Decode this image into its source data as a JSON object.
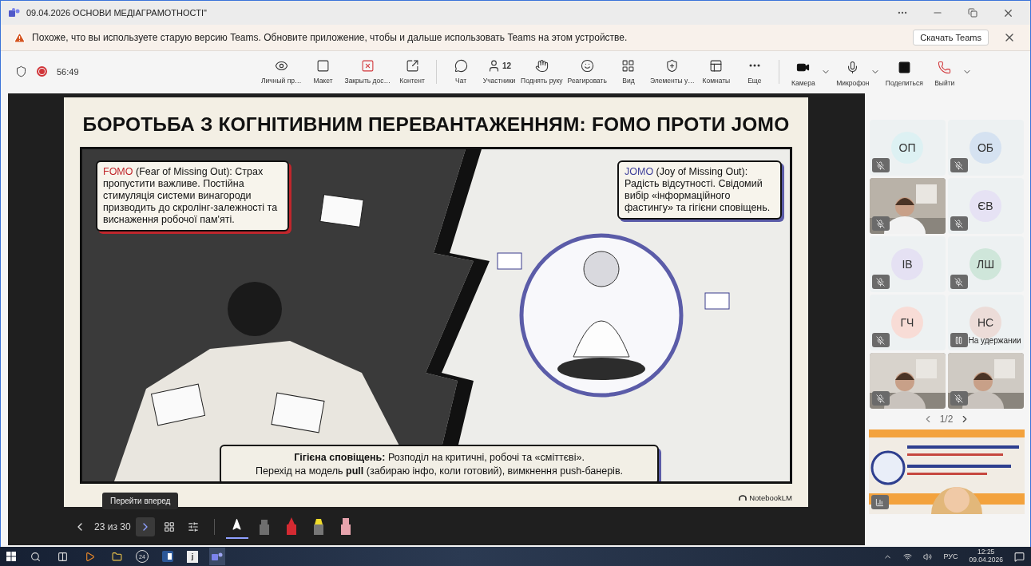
{
  "window": {
    "title": "09.04.2026 ОСНОВИ МЕДІАГРАМОТНОСТІ\""
  },
  "update_banner": {
    "message": "Похоже, что вы используете старую версию Teams. Обновите приложение, чтобы и дальше использовать Teams на этом устройстве.",
    "action": "Скачать Teams"
  },
  "meeting": {
    "recording": true,
    "timer": "56:49"
  },
  "toolbar": {
    "view_tools": [
      {
        "kind": "eye",
        "label": "Личный пр…"
      },
      {
        "kind": "layout",
        "label": "Макет"
      },
      {
        "kind": "stop-share",
        "label": "Закрыть дос…"
      },
      {
        "kind": "content",
        "label": "Контент"
      }
    ],
    "meeting_tools": [
      {
        "kind": "chat",
        "label": "Чат"
      },
      {
        "kind": "people",
        "label": "Участники",
        "count": "12"
      },
      {
        "kind": "hand",
        "label": "Поднять руку"
      },
      {
        "kind": "react",
        "label": "Реагировать"
      },
      {
        "kind": "grid",
        "label": "Вид"
      },
      {
        "kind": "apps",
        "label": "Элементы у…"
      },
      {
        "kind": "rooms",
        "label": "Комнаты"
      },
      {
        "kind": "more",
        "label": "Еще"
      }
    ],
    "device_tools": [
      {
        "kind": "camera",
        "label": "Камера",
        "menu": true
      },
      {
        "kind": "mic",
        "label": "Микрофон",
        "menu": true
      },
      {
        "kind": "share",
        "label": "Поделиться",
        "menu": false
      },
      {
        "kind": "leave",
        "label": "Выйти",
        "menu": true
      }
    ]
  },
  "slide": {
    "title": "БОРОТЬБА З КОГНІТИВНИМ ПЕРЕВАНТАЖЕННЯМ: FOMO ПРОТИ JOMO",
    "fomo": {
      "term": "FOMO",
      "expansion": " (Fear of Missing Out):",
      "body": "Страх пропустити важливе. Постійна стимуляція системи винагороди призводить до скролінг-залежності та виснаження робочої пам'яті."
    },
    "jomo": {
      "term": "JOMO",
      "expansion": " (Joy of Missing Out):",
      "body": "Радість відсутності. Свідомий вибір «інформаційного фастингу» та гігієни сповіщень."
    },
    "summary": [
      "**Гігієна сповіщень:** Розподіл на критичні, робочі та «сміттєві».",
      "Перехід на модель **pull** (забираю інфо, коли готовий), вимкнення push-банерів."
    ],
    "brand": "NotebookLM"
  },
  "presentation_controls": {
    "tooltip": "Перейти вперед",
    "counter": "23 из 30",
    "tools": [
      {
        "kind": "pointer",
        "selected": true
      },
      {
        "kind": "marker",
        "color": "#6e6e6e",
        "selected": false
      },
      {
        "kind": "pen",
        "color": "#d42a32",
        "selected": false
      },
      {
        "kind": "highlighter",
        "color": "#f0dc2a",
        "selected": false
      },
      {
        "kind": "eraser",
        "color": "#e7a3ad",
        "selected": false
      }
    ]
  },
  "participants": {
    "tiles": [
      {
        "kind": "avatar",
        "initials": "ОП",
        "color": "#ddf1f3",
        "muted": true
      },
      {
        "kind": "avatar",
        "initials": "ОБ",
        "color": "#d5e2f1",
        "muted": true
      },
      {
        "kind": "video",
        "muted": true
      },
      {
        "kind": "avatar",
        "initials": "ЄВ",
        "color": "#e6e2f4",
        "muted": true
      },
      {
        "kind": "avatar",
        "initials": "ІВ",
        "color": "#e5e1f3",
        "muted": true
      },
      {
        "kind": "avatar",
        "initials": "ЛШ",
        "color": "#cfe6da",
        "muted": true
      },
      {
        "kind": "avatar",
        "initials": "ГЧ",
        "color": "#f8dcd6",
        "muted": true
      },
      {
        "kind": "avatar",
        "initials": "НС",
        "color": "#ecdcd8",
        "muted": false,
        "status": "На удержании"
      },
      {
        "kind": "video",
        "muted": true
      },
      {
        "kind": "video",
        "muted": true
      }
    ],
    "pager": "1/2"
  },
  "taskbar": {
    "apps": [
      {
        "kind": "search"
      },
      {
        "kind": "taskview"
      },
      {
        "kind": "media"
      },
      {
        "kind": "explorer"
      },
      {
        "kind": "calendar",
        "label": "24"
      },
      {
        "kind": "word"
      },
      {
        "kind": "notes",
        "label": "j"
      },
      {
        "kind": "teams",
        "selected": true
      }
    ],
    "language": "РУС",
    "time": "12:25",
    "date": "09.04.2026"
  }
}
